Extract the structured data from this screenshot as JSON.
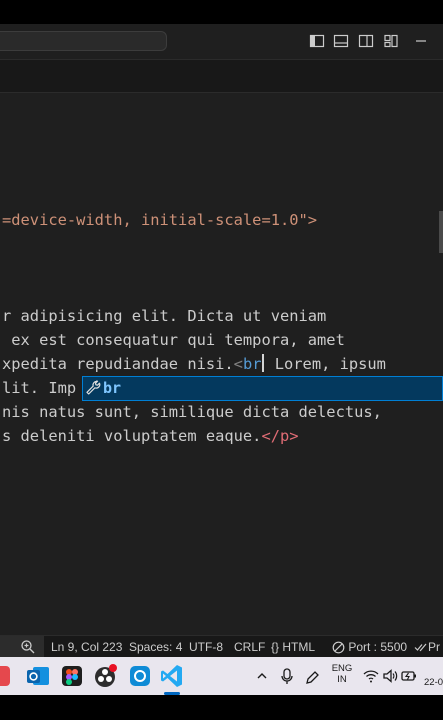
{
  "editor": {
    "lines": {
      "meta": "=device-width, initial-scale=1.0\">",
      "p1": "r adipisicing elit. Dicta ut veniam",
      "p2": " ex est consequatur qui tempora, amet",
      "p3_text": "xpedita repudiandae nisi.",
      "p3_lt": "<",
      "p3_tag": "br",
      "p3_after": " Lorem, ipsum",
      "p4": "lit. Imp",
      "p5": "nis natus sunt, similique dicta delectus,",
      "p6_text": "s deleniti voluptatem eaque.",
      "p6_endtag": "</p>"
    },
    "suggestion": {
      "icon": "wrench-icon",
      "label": "br"
    }
  },
  "statusbar": {
    "position": "Ln 9, Col 223",
    "spaces": "Spaces: 4",
    "encoding": "UTF-8",
    "eol": "CRLF",
    "language_braces": "{}",
    "language": "HTML",
    "port": "Port : 5500",
    "prettier": "Pr"
  },
  "taskbar": {
    "lang_line1": "ENG",
    "lang_line2": "IN",
    "date_partial": "22-0",
    "active_app": "vscode-icon"
  },
  "colors": {
    "editor_bg": "#1f1f1f",
    "attr_value": "#ce9178",
    "tag_name": "#569cd6",
    "end_tag": "#e06c75",
    "suggest_selected_bg": "#04395e",
    "taskbar_bg": "#e9e6ee",
    "accent": "#007acc"
  }
}
